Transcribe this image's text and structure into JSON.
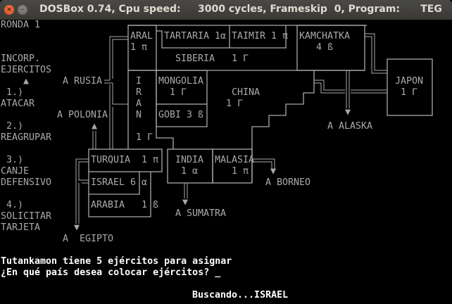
{
  "window": {
    "title": "DOSBox 0.74, Cpu speed:     3000 cycles, Frameskip  0, Program:      TEG",
    "close_glyph": "×",
    "min_glyph": "–"
  },
  "game": {
    "round": "RONDA 1",
    "menu": {
      "incorp_1": "INCORP.",
      "incorp_2": "EJERCITOS",
      "pointer": "▲",
      "opt1_num": "1.)",
      "opt1": "ATACAR",
      "opt2_num": "2.)",
      "opt2": "REAGRUPAR",
      "opt3_num": "3.)",
      "opt3_a": "CANJE",
      "opt3_b": "DEFENSIVO",
      "opt4_num": "4.)",
      "opt4_a": "SOLICITAR",
      "opt4_b": "TARJETA"
    },
    "exits": {
      "rusia": "A RUSIA",
      "polonia": "A POLONIA",
      "polonia_arrow": "▲",
      "egipto": "A  EGIPTO",
      "egipto_arrow": "▼",
      "alaska": "A ALASKA",
      "alaska_arrow": "▼",
      "sumatra": "A SUMATRA",
      "sumatra_arrow": "▼",
      "borneo": "A BORNEO",
      "borneo_arrow": "▼"
    },
    "countries": {
      "aral": {
        "name": "ARAL",
        "armies": "1 π"
      },
      "tartaria": {
        "name": "TARTARIA 1α"
      },
      "taimir": {
        "name": "TAIMIR 1 π"
      },
      "kamchatka": {
        "name": "KAMCHATKA",
        "armies": "4 ß"
      },
      "siberia": {
        "name": "SIBERIA",
        "armies": "1 Γ"
      },
      "iran": {
        "letters": [
          "I",
          "R",
          "A",
          "N"
        ],
        "armies": "1 Γ"
      },
      "mongolia": {
        "name": "MONGOLIA",
        "armies": "1 Γ"
      },
      "gobi": {
        "name": "GOBI 3 ß"
      },
      "china": {
        "name": "CHINA",
        "armies": "1 Γ"
      },
      "japon": {
        "name": "JAPON",
        "armies": "1 Γ"
      },
      "turquia": {
        "name": "TURQUIA  1 π"
      },
      "israel": {
        "name": "ISRAEL 6",
        "armies": "α"
      },
      "arabia": {
        "name": "ARABIA   1 ß"
      },
      "india": {
        "name": "INDIA",
        "armies": "1 α"
      },
      "malasia": {
        "name": "MALASIA",
        "armies": "1 π"
      }
    },
    "console": {
      "line1": "Tutankamon tiene 5 ejércitos para asignar",
      "line2": "¿En qué país desea colocar ejércitos? _",
      "status": "Buscando...ISRAEL"
    }
  },
  "colors": {
    "text": "#aaaaaa",
    "bright": "#ffffff",
    "background": "#000000",
    "close": "#e0542a"
  }
}
